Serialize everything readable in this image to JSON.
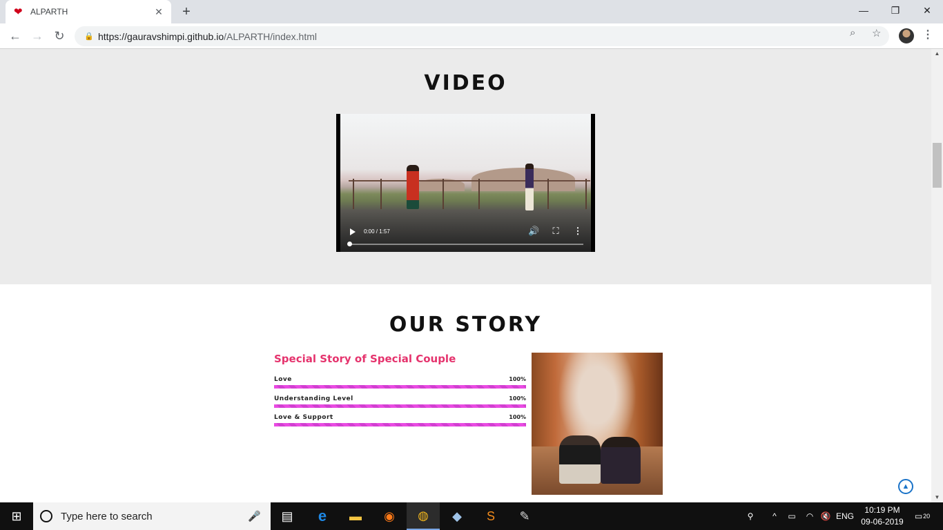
{
  "browser": {
    "tab_title": "ALPARTH",
    "url_host": "https://gauravshimpi.github.io",
    "url_path": "/ALPARTH/index.html",
    "new_tab": "+",
    "tab_close": "✕",
    "window_controls": {
      "minimize": "—",
      "restore": "❐",
      "close": "✕"
    }
  },
  "video_section": {
    "title": "VIDEO",
    "player": {
      "time": "0:00 / 1:57",
      "progress": 0.0
    }
  },
  "story_section": {
    "title": "OUR STORY",
    "heading": "Special Story of Special Couple",
    "skills": [
      {
        "label": "Love",
        "value": "100%",
        "fraction": 1.0
      },
      {
        "label": "Understanding Level",
        "value": "100%",
        "fraction": 1.0
      },
      {
        "label": "Love & Support",
        "value": "100%",
        "fraction": 1.0
      }
    ]
  },
  "taskbar": {
    "search_placeholder": "Type here to search",
    "language": "ENG",
    "time": "10:19 PM",
    "date": "09-06-2019",
    "notifications": "20"
  },
  "colors": {
    "accent_pink": "#e5336d",
    "bar_magenta": "#e94be2",
    "video_section_bg": "#ebebeb"
  }
}
